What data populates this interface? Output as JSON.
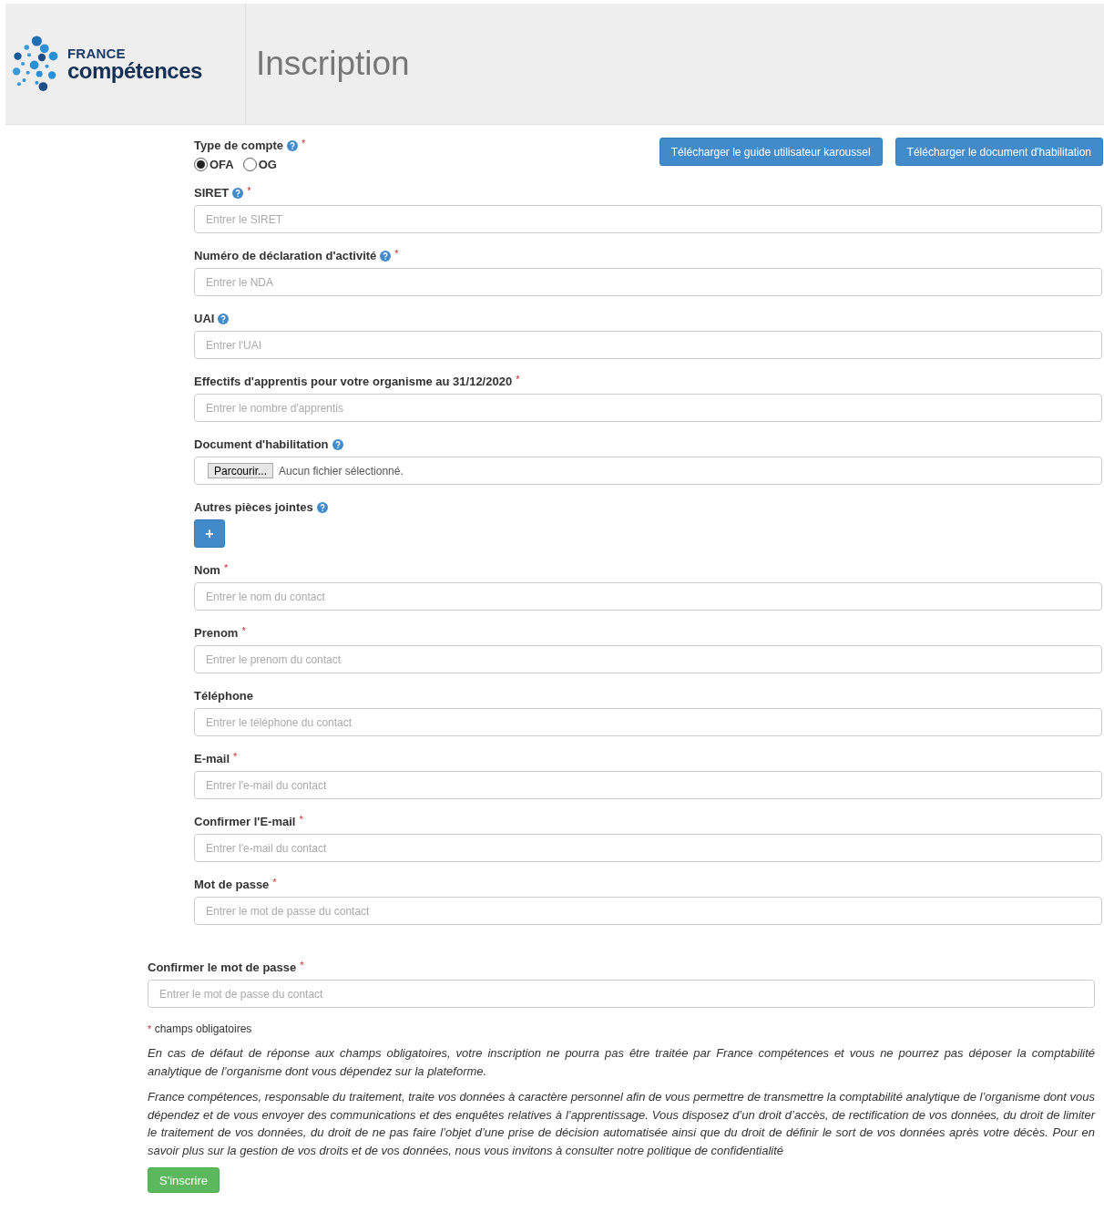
{
  "header": {
    "logo_top": "FRANCE",
    "logo_bottom": "compétences",
    "title": "Inscription"
  },
  "required_mark": "*",
  "account_type": {
    "label": "Type de compte",
    "help": true,
    "required": true,
    "options": [
      {
        "label": "OFA",
        "selected": true
      },
      {
        "label": "OG",
        "selected": false
      }
    ]
  },
  "downloads": [
    "Télécharger le guide utilisateur karoussel",
    "Télécharger le document d'habilitation"
  ],
  "fields": [
    {
      "kind": "text",
      "label": "SIRET",
      "help": true,
      "required": true,
      "placeholder": "Entrer le SIRET"
    },
    {
      "kind": "text",
      "label": "Numéro de déclaration d'activité",
      "help": true,
      "required": true,
      "placeholder": "Entrer le NDA"
    },
    {
      "kind": "text",
      "label": "UAI",
      "help": true,
      "required": false,
      "placeholder": "Entrer l'UAI"
    },
    {
      "kind": "text",
      "label": "Effectifs d'apprentis pour votre organisme au 31/12/2020",
      "help": false,
      "required": true,
      "placeholder": "Entrer le nombre d'apprentis"
    },
    {
      "kind": "file",
      "label": "Document d'habilitation",
      "help": true,
      "required": false,
      "button": "Parcourir...",
      "status": "Aucun fichier sélectionné."
    },
    {
      "kind": "attach",
      "label": "Autres pièces jointes",
      "help": true,
      "required": false,
      "button": "+"
    },
    {
      "kind": "text",
      "label": "Nom",
      "help": false,
      "required": true,
      "placeholder": "Entrer le nom du contact"
    },
    {
      "kind": "text",
      "label": "Prenom",
      "help": false,
      "required": true,
      "placeholder": "Entrer le prenom du contact"
    },
    {
      "kind": "text",
      "label": "Téléphone",
      "help": false,
      "required": false,
      "placeholder": "Entrer le téléphone du contact"
    },
    {
      "kind": "text",
      "label": "E-mail",
      "help": false,
      "required": true,
      "placeholder": "Entrer l'e-mail du contact"
    },
    {
      "kind": "text",
      "label": "Confirmer l'E-mail",
      "help": false,
      "required": true,
      "placeholder": "Entrer l'e-mail du contact"
    },
    {
      "kind": "text",
      "label": "Mot de passe",
      "help": false,
      "required": true,
      "placeholder": "Entrer le mot de passe du contact"
    }
  ],
  "confirm_password": {
    "label": "Confirmer le mot de passe",
    "help": false,
    "required": true,
    "placeholder": "Entrer le mot de passe du contact"
  },
  "required_note": "champs obligatoires",
  "paragraphs": [
    "En cas de défaut de réponse aux champs obligatoires, votre inscription ne pourra pas être traitée par France compétences et vous ne pourrez pas déposer la comptabilité analytique de l’organisme dont vous dépendez sur la plateforme.",
    "France compétences, responsable du traitement, traite vos données à caractère personnel afin de vous permettre de transmettre la comptabilité analytique de l’organisme dont vous dépendez et de vous envoyer des communications et des enquêtes relatives à l’apprentissage. Vous disposez d’un droit d’accès, de rectification de vos données, du droit de limiter le traitement de vos données, du droit de ne pas faire l’objet d’une prise de décision automatisée ainsi que du droit de définir le sort de vos données après votre décès. Pour en savoir plus sur la gestion de vos droits et de vos données, nous vous invitons à consulter notre politique de confidentialité"
  ],
  "submit": "S'inscrire"
}
